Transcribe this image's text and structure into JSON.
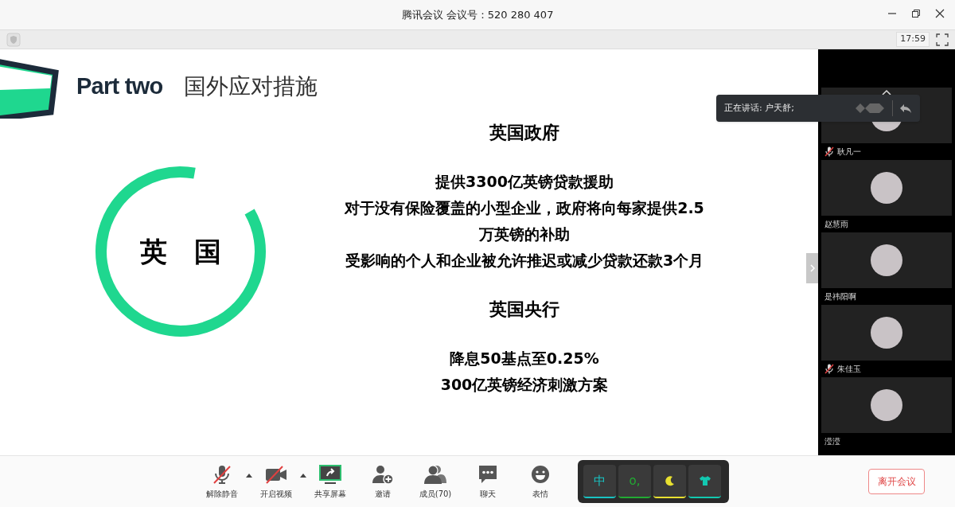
{
  "window": {
    "title": "腾讯会议 会议号：520 280 407"
  },
  "top_strip": {
    "time": "17:59"
  },
  "slide": {
    "part": "Part two",
    "heading": "国外应对措施",
    "ring_label": "英　国",
    "sections": [
      {
        "title": "英国政府",
        "lines": [
          "提供3300亿英镑贷款援助",
          "对于没有保险覆盖的小型企业，政府将向每家提供2.5",
          "万英镑的补助",
          "受影响的个人和企业被允许推迟或减少贷款还款3个月"
        ]
      },
      {
        "title": "英国央行",
        "lines": [
          "降息50基点至0.25%",
          "300亿英镑经济刺激方案"
        ]
      }
    ]
  },
  "speaking": {
    "text": "正在讲话: 户天舒;"
  },
  "participants": [
    {
      "name": "耿凡一",
      "muted": true
    },
    {
      "name": "赵慧雨",
      "muted": false
    },
    {
      "name": "是祎阳啊",
      "muted": false
    },
    {
      "name": "朱佳玉",
      "muted": true
    },
    {
      "name": "滢滢",
      "muted": false
    }
  ],
  "toolbar": [
    {
      "kind": "mic",
      "label": "解除静音",
      "on": false,
      "menu": true
    },
    {
      "kind": "video",
      "label": "开启视频",
      "on": false,
      "menu": true
    },
    {
      "kind": "share",
      "label": "共享屏幕"
    },
    {
      "kind": "invite",
      "label": "邀请"
    },
    {
      "kind": "members",
      "label": "成员(70)"
    },
    {
      "kind": "chat",
      "label": "聊天"
    },
    {
      "kind": "emoji",
      "label": "表情"
    }
  ],
  "ime_keys": [
    {
      "kind": "text",
      "label": "中",
      "color": "#19c3c3"
    },
    {
      "kind": "text",
      "label": "o,",
      "color": "#22aa33"
    },
    {
      "kind": "moon",
      "color": "#e8e030"
    },
    {
      "kind": "shirt",
      "color": "#12c8b0"
    }
  ],
  "leave": {
    "label": "离开会议"
  }
}
